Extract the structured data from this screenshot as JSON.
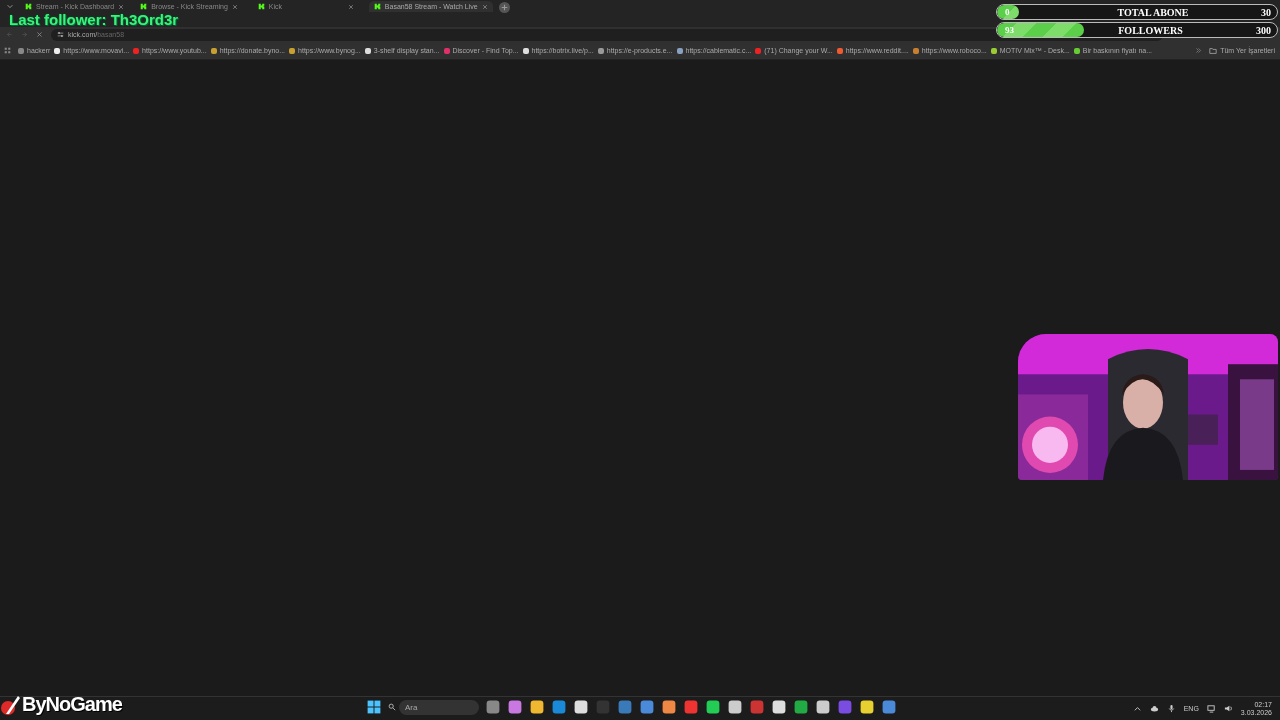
{
  "tabs": [
    {
      "label": "Stream - Kick Dashboard",
      "selected": false
    },
    {
      "label": "Browse - Kick Streaming",
      "selected": false
    },
    {
      "label": "Kick",
      "selected": false
    },
    {
      "label": "Basan58 Stream - Watch Live",
      "selected": true
    }
  ],
  "address": {
    "host": "kick.com/",
    "path": "basan58"
  },
  "bookmarks": [
    "hackerr",
    "https://www.movavi...",
    "https://www.youtub...",
    "https://donate.byno...",
    "https://www.bynog...",
    "3-shelf display stan...",
    "Discover - Find Top...",
    "https://botrix.live/p...",
    "https://e-products.e...",
    "https://cablematic.c...",
    "(71) Change your W...",
    "https://www.reddit....",
    "https://www.roboco...",
    "MOTIV Mix™ - Desk...",
    "Bir baskının fiyatı na..."
  ],
  "all_bookmarks": "Tüm Yer İşaretleri",
  "overlay": {
    "last_follower": "Last follower: Th3Ord3r",
    "goals": [
      {
        "value": "0",
        "title": "TOTAL ABONE",
        "target": "30",
        "level": 0
      },
      {
        "value": "93",
        "title": "FOLLOWERS",
        "target": "300",
        "level": 0.31
      }
    ],
    "logo": "ByNoGame"
  },
  "taskbar": {
    "search": {
      "placeholder": "Ara"
    },
    "language": "ENG",
    "time": "02:17",
    "date": "3.03.2026"
  }
}
